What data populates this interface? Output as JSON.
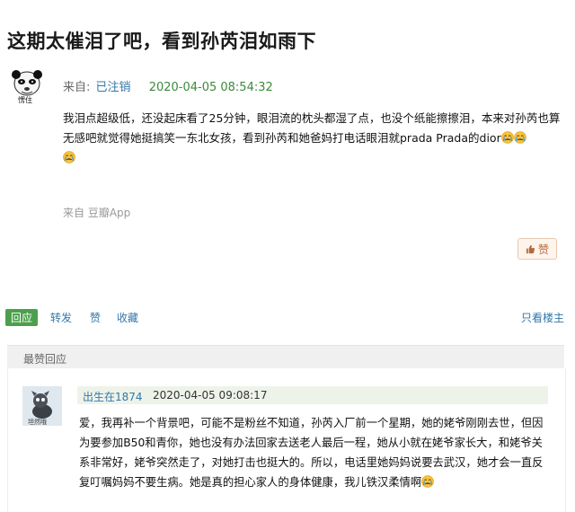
{
  "post": {
    "title": "这期太催泪了吧，看到孙芮泪如雨下",
    "meta_prefix": "来自:",
    "author": "已注销",
    "timestamp": "2020-04-05 08:54:32",
    "avatar_caption": "愣住",
    "content_text": "我泪点超级低，还没起床看了25分钟，眼泪流的枕头都湿了点，也没个纸能擦擦泪，本来对孙芮也算无感吧就觉得她挺搞笑一东北女孩，看到孙芮和她爸妈打电话眼泪就prada Prada的dior",
    "emoji_icon": "crying-emoji",
    "source": "来自 豆瓣App",
    "like_label": "赞"
  },
  "actions": {
    "reply": "回应",
    "share": "转发",
    "like": "赞",
    "collect": "收藏",
    "only_poster": "只看楼主"
  },
  "best_replies": {
    "header": "最赞回应",
    "items": [
      {
        "author": "出生在1874",
        "timestamp": "2020-04-05 09:08:17",
        "avatar_caption": "坦然哦",
        "text": "爱，我再补一个背景吧，可能不是粉丝不知道，孙芮入厂前一个星期，她的姥爷刚刚去世，但因为要参加B50和青你，她也没有办法回家去送老人最后一程，她从小就在姥爷家长大，和姥爷关系非常好，姥爷突然走了，对她打击也挺大的。所以，电话里她妈妈说要去武汉，她才会一直反复叮嘱妈妈不要生病。她是真的担心家人的身体健康，我儿铁汉柔情啊"
      }
    ]
  },
  "colors": {
    "link": "#3377aa",
    "timestamp_green": "#3a8a3a",
    "reply_green": "#4c9f4c",
    "like_bg": "#fff4ec"
  }
}
